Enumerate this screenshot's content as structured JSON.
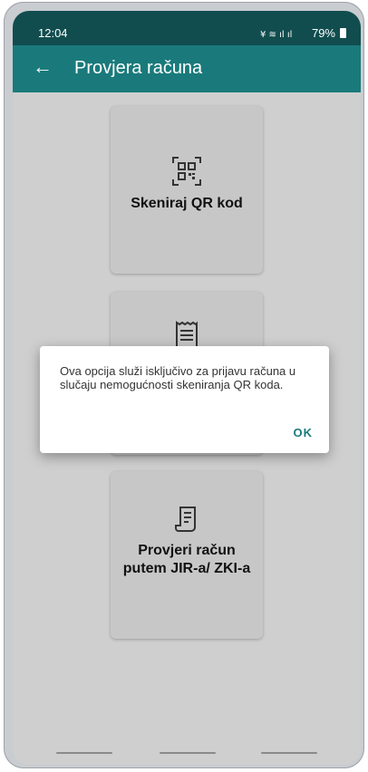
{
  "status_bar": {
    "time": "12:04",
    "signal_text": "✖📶",
    "battery": "79%"
  },
  "app_bar": {
    "title": "Provjera računa",
    "back_icon": "arrow-left-icon"
  },
  "cards": [
    {
      "label": "Skeniraj QR kod",
      "icon": "qr-code-icon"
    },
    {
      "label": "",
      "icon": "receipt-icon"
    },
    {
      "label": "Provjeri račun putem JIR-a/ ZKI-a",
      "icon": "receipt-icon"
    }
  ],
  "dialog": {
    "message": "Ova opcija služi isključivo za prijavu računa u slučaju nemogućnosti skeniranja QR koda.",
    "ok_label": "OK"
  },
  "colors": {
    "primary_dark": "#114d4f",
    "primary": "#1a7a7b",
    "accent": "#1a7a7b"
  }
}
